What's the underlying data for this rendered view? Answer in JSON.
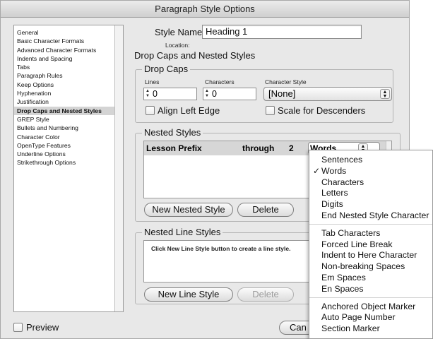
{
  "window": {
    "title": "Paragraph Style Options"
  },
  "sidebar": {
    "items": [
      {
        "label": "General",
        "selected": false
      },
      {
        "label": "Basic Character Formats",
        "selected": false
      },
      {
        "label": "Advanced Character Formats",
        "selected": false
      },
      {
        "label": "Indents and Spacing",
        "selected": false
      },
      {
        "label": "Tabs",
        "selected": false
      },
      {
        "label": "Paragraph Rules",
        "selected": false
      },
      {
        "label": "Keep Options",
        "selected": false
      },
      {
        "label": "Hyphenation",
        "selected": false
      },
      {
        "label": "Justification",
        "selected": false
      },
      {
        "label": "Drop Caps and Nested Styles",
        "selected": true
      },
      {
        "label": "GREP Style",
        "selected": false
      },
      {
        "label": "Bullets and Numbering",
        "selected": false
      },
      {
        "label": "Character Color",
        "selected": false
      },
      {
        "label": "OpenType Features",
        "selected": false
      },
      {
        "label": "Underline Options",
        "selected": false
      },
      {
        "label": "Strikethrough Options",
        "selected": false
      }
    ]
  },
  "header": {
    "style_name_label": "Style Name:",
    "style_name_value": "Heading 1",
    "location_label": "Location:",
    "section_title": "Drop Caps and Nested Styles"
  },
  "drop_caps": {
    "title": "Drop Caps",
    "lines_label": "Lines",
    "lines_value": "0",
    "characters_label": "Characters",
    "characters_value": "0",
    "character_style_label": "Character Style",
    "character_style_value": "[None]",
    "align_left_edge_label": "Align Left Edge",
    "scale_descenders_label": "Scale for Descenders"
  },
  "nested_styles": {
    "title": "Nested Styles",
    "row": {
      "style": "Lesson Prefix",
      "mode": "through",
      "count": "2",
      "unit": "Words"
    },
    "new_button": "New Nested Style",
    "delete_button": "Delete"
  },
  "nested_line_styles": {
    "title": "Nested Line Styles",
    "hint": "Click New Line Style button to create a line style.",
    "new_button": "New Line Style",
    "delete_button": "Delete"
  },
  "footer": {
    "preview_label": "Preview",
    "cancel_button": "Can"
  },
  "dropdown_menu": {
    "group1": [
      "Sentences",
      "Words",
      "Characters",
      "Letters",
      "Digits",
      "End Nested Style Character"
    ],
    "checked": "Words",
    "group2": [
      "Tab Characters",
      "Forced Line Break",
      "Indent to Here Character",
      "Non-breaking Spaces",
      "Em Spaces",
      "En Spaces"
    ],
    "group3": [
      "Anchored Object Marker",
      "Auto Page Number",
      "Section Marker"
    ]
  }
}
